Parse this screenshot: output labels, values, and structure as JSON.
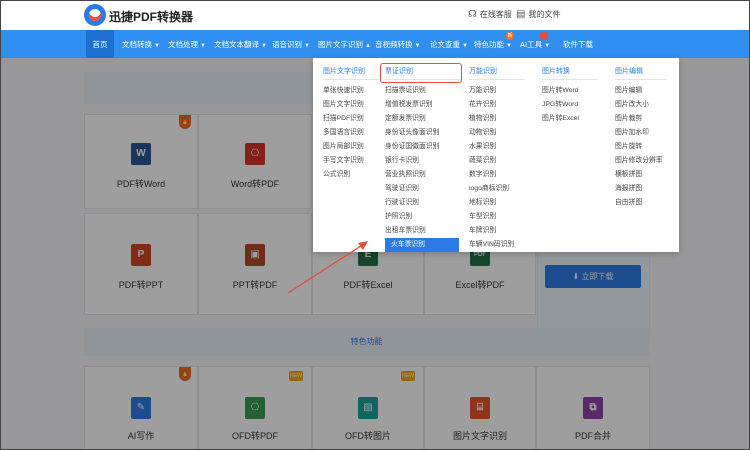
{
  "header": {
    "brand": "迅捷PDF转换器",
    "online_service": "在线客服",
    "my_files": "我的文件"
  },
  "nav": {
    "items": [
      "首页",
      "文档转换",
      "文档处理",
      "文档文本翻译",
      "语音识别",
      "图片文字识别",
      "音视频转换",
      "论文查重",
      "特色功能",
      "AI工具",
      "软件下载"
    ],
    "badge_text": "新"
  },
  "dropdown": {
    "col1": {
      "head": "图片文字识别",
      "items": [
        "单张快速识别",
        "图片文字识别",
        "扫描PDF识别",
        "多国语言识别",
        "图片局部识别",
        "手写文字识别",
        "公式识别"
      ]
    },
    "col2": {
      "head": "票证识别",
      "items": [
        "扫描票证识别",
        "增值税发票识别",
        "定额发票识别",
        "身份证头像面识别",
        "身份证国徽面识别",
        "银行卡识别",
        "营业执照识别",
        "驾驶证识别",
        "行驶证识别",
        "护照识别",
        "出租车票识别",
        "火车票识别"
      ]
    },
    "col3": {
      "head": "万能识别",
      "items": [
        "万能识别",
        "花卉识别",
        "植物识别",
        "动物识别",
        "水果识别",
        "蔬菜识别",
        "数字识别",
        "logo商标识别",
        "地标识别",
        "车型识别",
        "车牌识别",
        "车辆VIN码识别"
      ]
    },
    "col4": {
      "head": "图片转换",
      "items": [
        "图片转Word",
        "JPG转Word",
        "图片转Excel"
      ]
    },
    "col5": {
      "head": "图片编辑",
      "items": [
        "图片编辑",
        "图片改大小",
        "图片裁剪",
        "图片加水印",
        "图片旋转",
        "图片修改分辨率",
        "横板拼图",
        "海报拼图",
        "自由拼图"
      ]
    }
  },
  "cards": {
    "pdf_to_word": "PDF转Word",
    "word_to_pdf": "Word转PDF",
    "pdf_to_ppt": "PDF转PPT",
    "ppt_to_pdf": "PPT转PDF",
    "pdf_to_excel": "PDF转Excel",
    "excel_to_pdf": "Excel转PDF",
    "download_now": "立即下载",
    "featured_section": "特色功能",
    "ai_writing": "AI写作",
    "ofd_to_pdf": "OFD转PDF",
    "ofd_to_image": "OFD转图片",
    "image_text_recog": "图片文字识别",
    "pdf_merge": "PDF合并",
    "new_tag": "NEW",
    "icon_letters": {
      "word": "W",
      "ppt": "P",
      "pdf_short": "PDF"
    }
  },
  "colors": {
    "nav_blue": "#2e8ff0",
    "accent": "#2c7be5",
    "highlight_box": "#e74c3c"
  }
}
